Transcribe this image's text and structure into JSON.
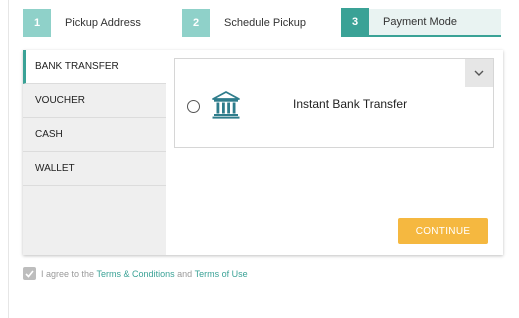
{
  "stepper": {
    "steps": [
      {
        "number": "1",
        "label": "Pickup Address"
      },
      {
        "number": "2",
        "label": "Schedule Pickup"
      },
      {
        "number": "3",
        "label": "Payment Mode"
      }
    ],
    "active_step": 3
  },
  "payment_methods": {
    "items": [
      {
        "label": "BANK TRANSFER"
      },
      {
        "label": "VOUCHER"
      },
      {
        "label": "CASH"
      },
      {
        "label": "WALLET"
      }
    ],
    "active": "BANK TRANSFER"
  },
  "bank_transfer": {
    "option_label": "Instant Bank Transfer",
    "icon": "bank-icon",
    "dropdown_icon": "chevron-down-icon"
  },
  "actions": {
    "continue_label": "CONTINUE"
  },
  "agreement": {
    "prefix": "I agree to the ",
    "terms_link": "Terms & Conditions",
    "middle": " and ",
    "terms_of_use_link": "Terms of Use"
  },
  "colors": {
    "accent": "#3aa296",
    "accent_light": "#8fd1c9",
    "button": "#f5b840"
  }
}
